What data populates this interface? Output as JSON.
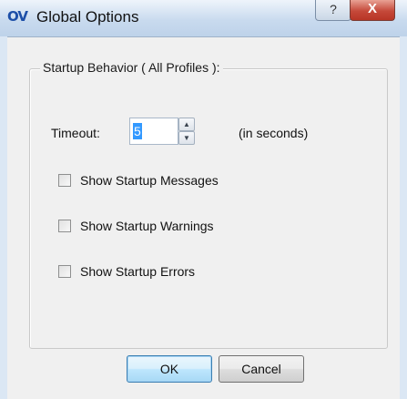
{
  "window": {
    "title": "Global Options",
    "app_icon_text": "OV",
    "help_button": "?",
    "close_button": "X"
  },
  "group": {
    "label": "Startup Behavior ( All Profiles ):"
  },
  "timeout": {
    "label": "Timeout:",
    "value": "5",
    "unit": "(in seconds)",
    "up_glyph": "▲",
    "down_glyph": "▼"
  },
  "checkboxes": [
    {
      "label": "Show Startup Messages",
      "checked": false
    },
    {
      "label": "Show Startup Warnings",
      "checked": false
    },
    {
      "label": "Show Startup Errors",
      "checked": false
    }
  ],
  "buttons": {
    "ok": "OK",
    "cancel": "Cancel"
  }
}
